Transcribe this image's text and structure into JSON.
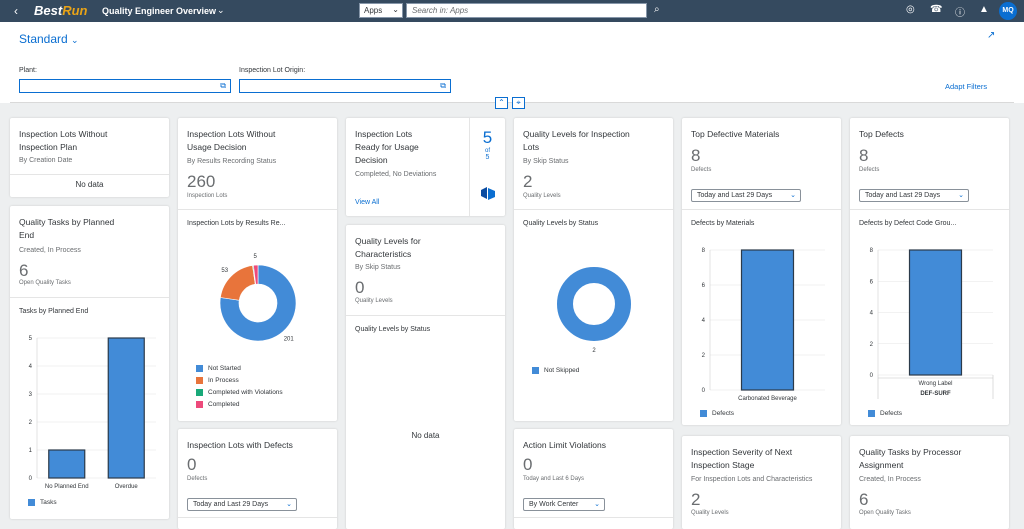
{
  "shell": {
    "logo_main": "Best",
    "logo_accent": "Run",
    "app_title": "Quality Engineer Overview",
    "apps_select": "Apps",
    "search_placeholder": "Search in: Apps",
    "user_initials": "MQ"
  },
  "header": {
    "variant": "Standard",
    "plant_label": "Plant:",
    "origin_label": "Inspection Lot Origin:",
    "adapt_filters": "Adapt Filters"
  },
  "colors": {
    "blue": "#428bd7",
    "orange": "#e8743b",
    "green": "#19a979",
    "pink": "#ed4a7b"
  },
  "cards": {
    "lots_without_plan": {
      "title_1": "Inspection Lots Without",
      "title_2": "Inspection Plan",
      "sub": "By Creation Date",
      "nodata": "No data"
    },
    "tasks_planned_end": {
      "title_1": "Quality Tasks by Planned",
      "title_2": "End",
      "sub": "Created, In Process",
      "kpi": "6",
      "kpi_label": "Open Quality Tasks",
      "chart_title": "Tasks by Planned End",
      "legend": "Tasks"
    },
    "lots_usage_decision": {
      "title_1": "Inspection Lots Without",
      "title_2": "Usage Decision",
      "sub": "By Results Recording Status",
      "kpi": "260",
      "kpi_label": "Inspection Lots",
      "chart_title": "Inspection Lots by Results Re...",
      "legend": [
        "Not Started",
        "In Process",
        "Completed with Violations",
        "Completed"
      ]
    },
    "lots_with_defects": {
      "title": "Inspection Lots with Defects",
      "kpi": "0",
      "kpi_label": "Defects",
      "dropdown": "Today and Last 29 Days"
    },
    "ready_usage": {
      "title_1": "Inspection Lots",
      "title_2": "Ready for Usage",
      "title_3": "Decision",
      "sub": "Completed, No Deviations",
      "view_all": "View All",
      "count": "5",
      "of": "of",
      "total": "5"
    },
    "levels_characteristics": {
      "title_1": "Quality Levels for",
      "title_2": "Characteristics",
      "sub": "By Skip Status",
      "kpi": "0",
      "kpi_label": "Quality Levels",
      "chart_title": "Quality Levels by Status",
      "nodata": "No data"
    },
    "levels_inspection_lots": {
      "title_1": "Quality Levels for Inspection",
      "title_2": "Lots",
      "sub": "By Skip Status",
      "kpi": "2",
      "kpi_label": "Quality Levels",
      "chart_title": "Quality Levels by Status",
      "legend": "Not Skipped"
    },
    "action_limit": {
      "title": "Action Limit Violations",
      "kpi": "0",
      "kpi_label": "Today and Last 6 Days",
      "dropdown": "By Work Center"
    },
    "top_materials": {
      "title": "Top Defective Materials",
      "kpi": "8",
      "kpi_label": "Defects",
      "dropdown": "Today and Last 29 Days",
      "chart_title": "Defects by Materials",
      "legend": "Defects"
    },
    "severity": {
      "title_1": "Inspection Severity of Next",
      "title_2": "Inspection Stage",
      "sub": "For Inspection Lots and Characteristics",
      "kpi": "2",
      "kpi_label": "Quality Levels"
    },
    "top_defects": {
      "title": "Top Defects",
      "kpi": "8",
      "kpi_label": "Defects",
      "dropdown": "Today and Last 29 Days",
      "chart_title": "Defects by Defect Code Grou...",
      "legend": "Defects"
    },
    "tasks_processor": {
      "title_1": "Quality Tasks by Processor",
      "title_2": "Assignment",
      "sub": "Created, In Process",
      "kpi": "6",
      "kpi_label": "Open Quality Tasks"
    }
  },
  "chart_data": [
    {
      "type": "bar",
      "categories": [
        "No Planned End",
        "Overdue"
      ],
      "series": [
        {
          "name": "Tasks",
          "values": [
            1,
            5
          ]
        }
      ],
      "ylim": [
        0,
        5
      ],
      "yticks": [
        "0",
        "1",
        "2",
        "3",
        "4",
        "5"
      ]
    },
    {
      "type": "pie",
      "categories": [
        "Not Started",
        "In Process",
        "Completed with Violations",
        "Completed"
      ],
      "values": [
        201,
        53,
        1,
        5
      ],
      "data_labels": [
        "201",
        "53",
        "",
        "5"
      ]
    },
    {
      "type": "pie",
      "categories": [
        "Not Skipped"
      ],
      "values": [
        2
      ],
      "data_labels": [
        "2"
      ]
    },
    {
      "type": "bar",
      "categories": [
        "Carbonated Beverage"
      ],
      "series": [
        {
          "name": "Defects",
          "values": [
            8
          ]
        }
      ],
      "ylim": [
        0,
        8
      ],
      "yticks": [
        "0",
        "2",
        "4",
        "6",
        "8"
      ]
    },
    {
      "type": "bar",
      "categories": [
        "Wrong Label"
      ],
      "group_label": "DEF-SURF",
      "series": [
        {
          "name": "Defects",
          "values": [
            8
          ]
        }
      ],
      "ylim": [
        0,
        8
      ],
      "yticks": [
        "0",
        "2",
        "4",
        "6",
        "8"
      ]
    }
  ]
}
